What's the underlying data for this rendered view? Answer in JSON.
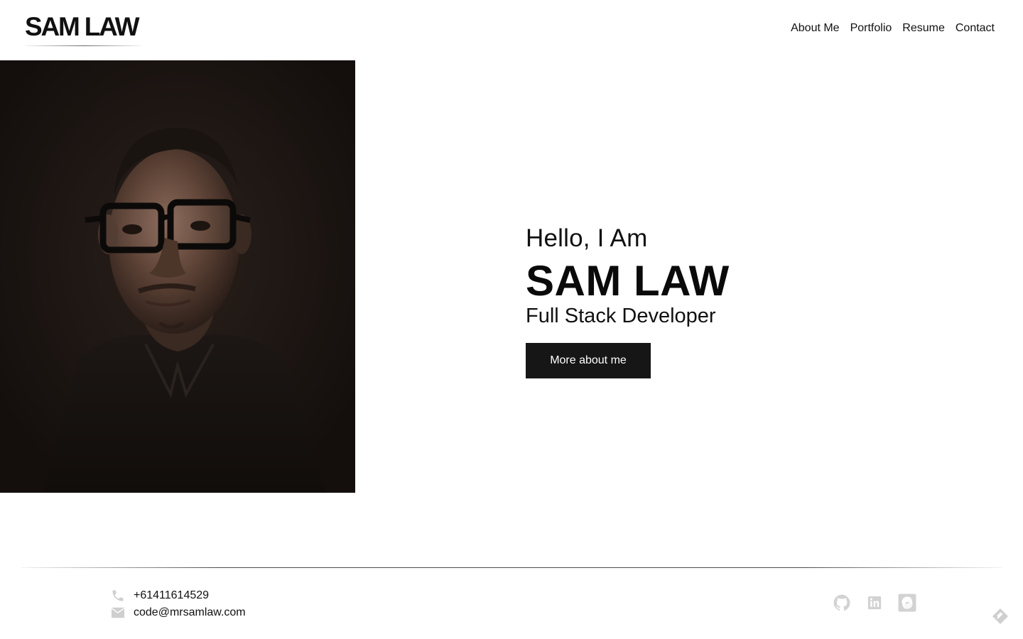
{
  "header": {
    "logo_text": "SAM LAW",
    "nav": [
      {
        "label": "About Me"
      },
      {
        "label": "Portfolio"
      },
      {
        "label": "Resume"
      },
      {
        "label": "Contact"
      }
    ]
  },
  "hero": {
    "greeting": "Hello, I Am",
    "name": "SAM LAW",
    "role": "Full Stack Developer",
    "button_label": "More about me"
  },
  "footer": {
    "phone": "+61411614529",
    "email": "code@mrsamlaw.com",
    "social": [
      {
        "icon": "github-icon"
      },
      {
        "icon": "linkedin-icon"
      },
      {
        "icon": "codepen-icon"
      }
    ]
  },
  "colors": {
    "text": "#111111",
    "button_bg": "#161616",
    "button_text": "#ffffff",
    "icon_grey": "#c8c8c8",
    "portrait_bg": "#17120f"
  }
}
